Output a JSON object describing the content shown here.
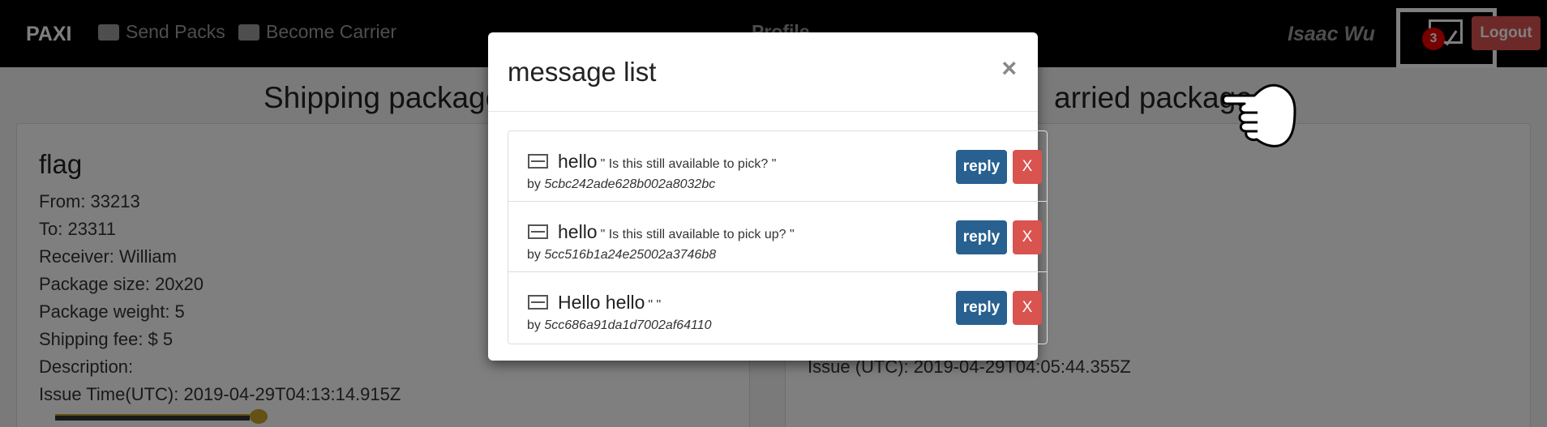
{
  "navbar": {
    "brand": "PAXI",
    "send_packs": "Send Packs",
    "become_carrier": "Become Carrier",
    "profile": "Profile",
    "user_name": "Isaac Wu",
    "message_badge": "3",
    "logout": "Logout"
  },
  "page": {
    "left_title": "Shipping package",
    "right_title": "arried packages",
    "package": {
      "title": "flag",
      "from": "From: 33213",
      "to": "To: 23311",
      "receiver": "Receiver: William",
      "size": "Package size: 20x20",
      "weight": "Package weight: 5",
      "fee": "Shipping fee: $ 5",
      "description": "Description:",
      "issue_time": "Issue Time(UTC): 2019-04-29T04:13:14.915Z"
    },
    "right_issue": "Issue (UTC): 2019-04-29T04:05:44.355Z"
  },
  "modal": {
    "title": "message list",
    "close": "×",
    "messages": [
      {
        "subject": "hello",
        "body": "\" Is this still available to pick? \"",
        "by_label": "by",
        "sender": "5cbc242ade628b002a8032bc",
        "reply": "reply",
        "delete": "X"
      },
      {
        "subject": "hello",
        "body": "\" Is this still available to pick up? \"",
        "by_label": "by",
        "sender": "5cc516b1a24e25002a3746b8",
        "reply": "reply",
        "delete": "X"
      },
      {
        "subject": "Hello hello",
        "body": "\" \"",
        "by_label": "by",
        "sender": "5cc686a91da1d7002af64110",
        "reply": "reply",
        "delete": "X"
      }
    ]
  },
  "colors": {
    "navbar_bg": "#000000",
    "reply_button": "#286090",
    "delete_button": "#d9534f",
    "badge": "#ee0000"
  },
  "icons": [
    "send-packs-icon",
    "car-icon",
    "mail-icon",
    "envelope-icon",
    "pointing-hand-icon",
    "close-icon"
  ]
}
